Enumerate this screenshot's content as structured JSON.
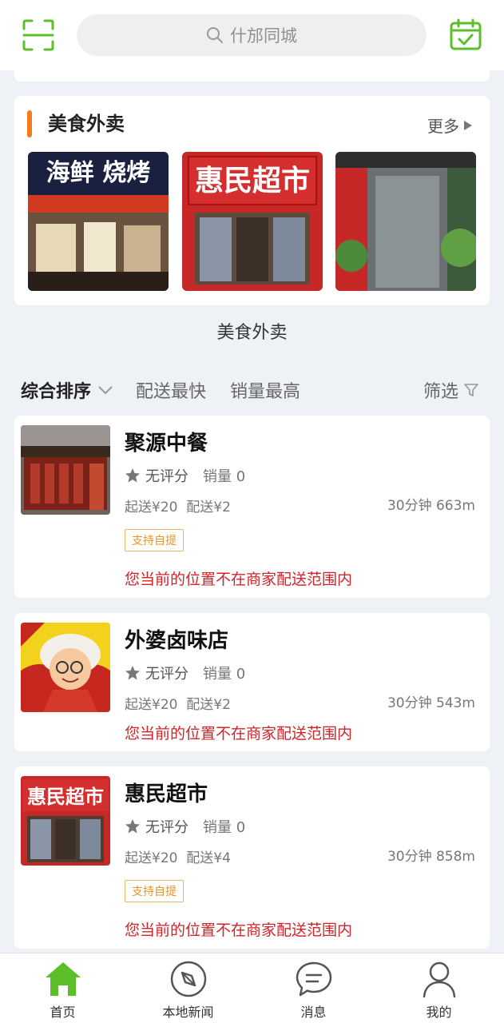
{
  "header": {
    "search_placeholder": "什邡同城",
    "scan_icon": "scan-icon",
    "calendar_icon": "calendar-check-icon",
    "accent": "#5cbf2a"
  },
  "food_section": {
    "title": "美食外卖",
    "more": "更多",
    "accent": "#f47a1a",
    "thumbnails": [
      {
        "sign": "海鲜 烧烤"
      },
      {
        "sign": "惠民超市"
      },
      {
        "sign": ""
      }
    ],
    "caption": "美食外卖"
  },
  "filters": {
    "sort": "综合排序",
    "fastest": "配送最快",
    "best_selling": "销量最高",
    "filter": "筛选"
  },
  "shops": [
    {
      "name": "聚源中餐",
      "rating": "无评分",
      "sales": "销量 0",
      "min_order": "起送¥20",
      "delivery_fee": "配送¥2",
      "distance": "30分钟 663m",
      "tag": "支持自提",
      "warning": "您当前的位置不在商家配送范围内"
    },
    {
      "name": "外婆卤味店",
      "rating": "无评分",
      "sales": "销量 0",
      "min_order": "起送¥20",
      "delivery_fee": "配送¥2",
      "distance": "30分钟 543m",
      "warning": "您当前的位置不在商家配送范围内"
    },
    {
      "name": "惠民超市",
      "image_sign": "惠民超市",
      "rating": "无评分",
      "sales": "销量 0",
      "min_order": "起送¥20",
      "delivery_fee": "配送¥4",
      "distance": "30分钟 858m",
      "tag": "支持自提",
      "warning": "您当前的位置不在商家配送范围内"
    }
  ],
  "bottom_nav": [
    {
      "label": "首页",
      "icon": "home-icon",
      "active": true
    },
    {
      "label": "本地新闻",
      "icon": "compass-icon"
    },
    {
      "label": "消息",
      "icon": "message-icon"
    },
    {
      "label": "我的",
      "icon": "user-icon"
    }
  ],
  "colors": {
    "warning": "#d0242a",
    "tag": "#e69524",
    "nav_active": "#5cbf2a"
  }
}
